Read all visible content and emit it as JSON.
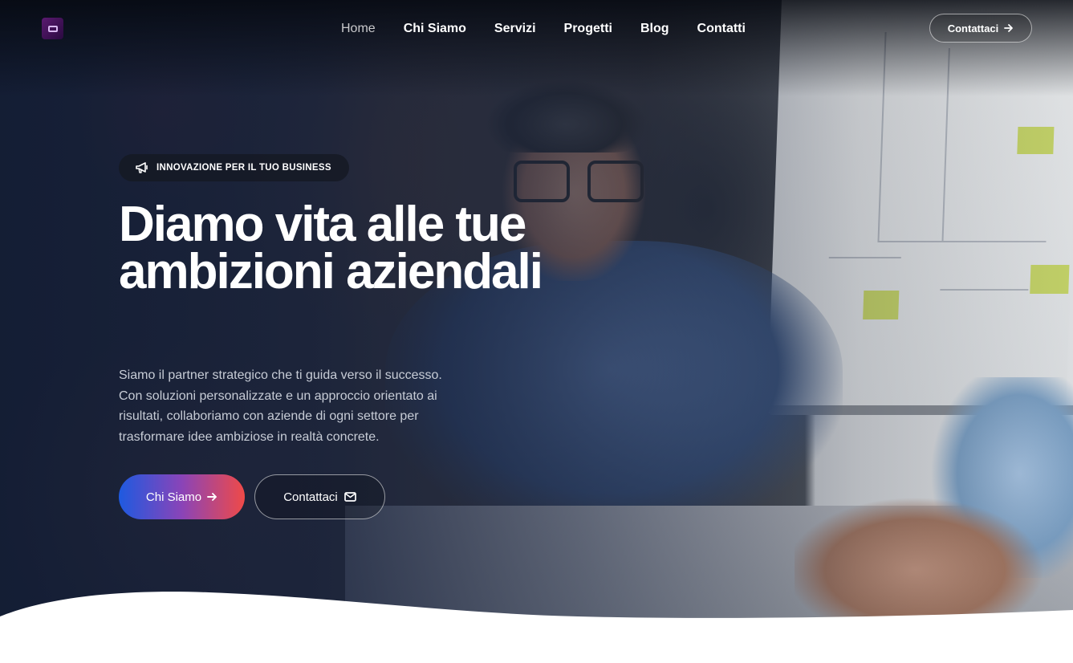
{
  "nav": {
    "items": [
      {
        "label": "Home",
        "active": true
      },
      {
        "label": "Chi Siamo",
        "active": false
      },
      {
        "label": "Servizi",
        "active": false
      },
      {
        "label": "Progetti",
        "active": false
      },
      {
        "label": "Blog",
        "active": false
      },
      {
        "label": "Contatti",
        "active": false
      }
    ],
    "cta_label": "Contattaci",
    "cta_icon": "arrow-right-icon"
  },
  "hero": {
    "badge_icon": "megaphone-icon",
    "badge_text": "INNOVAZIONE PER IL TUO BUSINESS",
    "title": "Diamo vita alle tue ambizioni aziendali",
    "subtitle": "Siamo il partner strategico che ti guida verso il successo. Con soluzioni personalizzate e un approccio orientato ai risultati, collaboriamo con aziende di ogni settore per trasformare idee ambiziose in realtà concrete.",
    "primary_button": {
      "label": "Chi Siamo",
      "icon": "arrow-right-icon"
    },
    "secondary_button": {
      "label": "Contattaci",
      "icon": "envelope-icon"
    }
  },
  "colors": {
    "gradient_start": "#1e5ae0",
    "gradient_mid": "#8a44b8",
    "gradient_end": "#ef4a48",
    "overlay": "#121c34"
  }
}
